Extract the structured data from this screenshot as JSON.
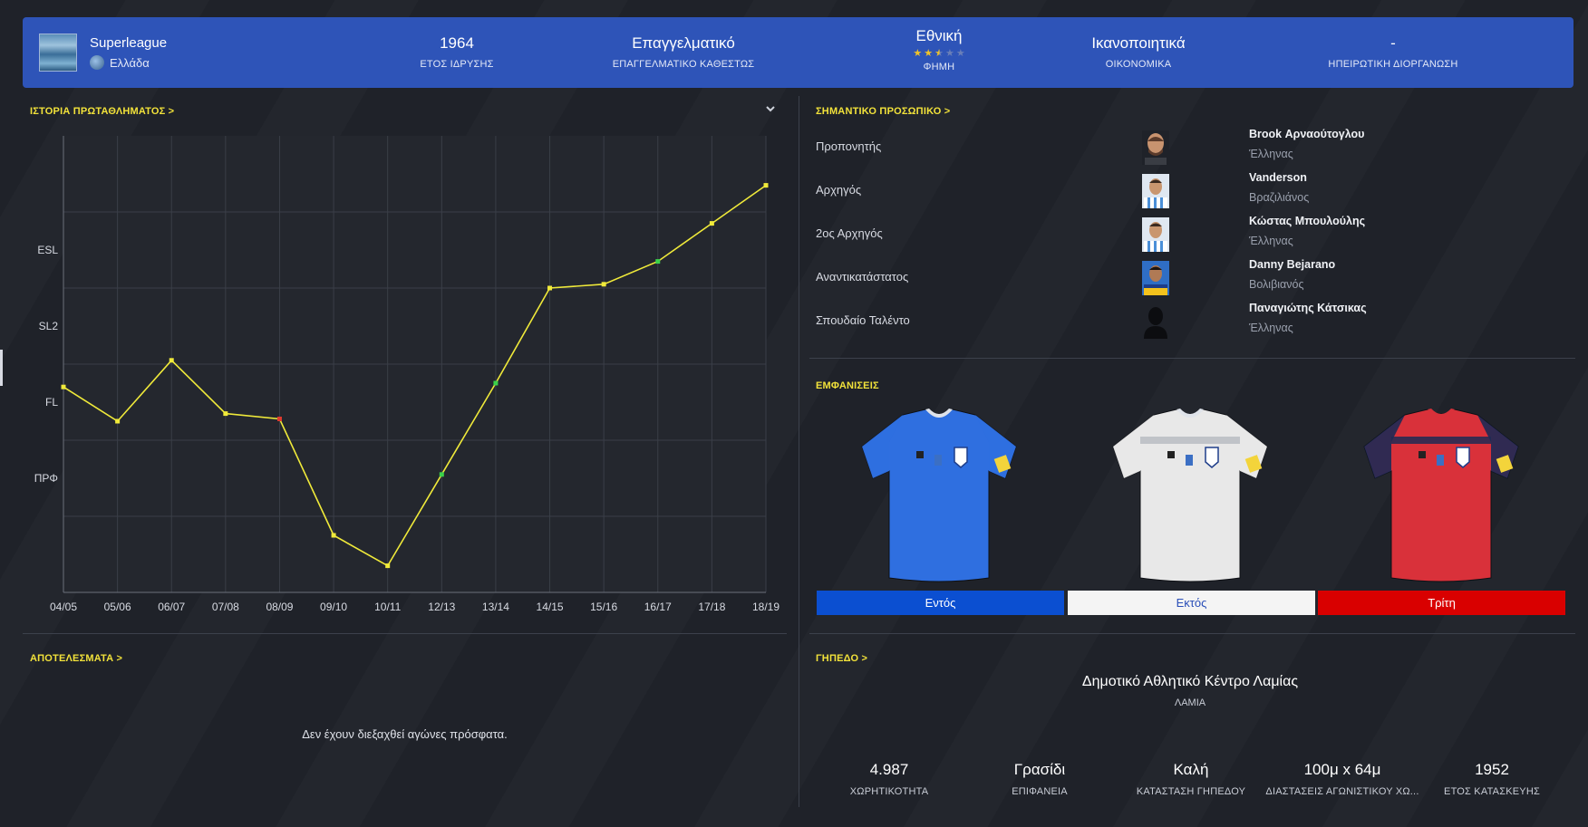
{
  "header": {
    "competition": "Superleague",
    "country": "Ελλάδα",
    "stats": [
      {
        "value": "1964",
        "label": "ΕΤΟΣ ΙΔΡΥΣΗΣ"
      },
      {
        "value": "Επαγγελματικό",
        "label": "ΕΠΑΓΓΕΛΜΑΤΙΚΟ ΚΑΘΕΣΤΩΣ"
      },
      {
        "value": "Εθνική",
        "label": "ΦΗΜΗ",
        "rating": 2.5,
        "rating_max": 5
      },
      {
        "value": "Ικανοποιητικά",
        "label": "ΟΙΚΟΝΟΜΙΚΑ"
      },
      {
        "value": "-",
        "label": "ΗΠΕΙΡΩΤΙΚΗ ΔΙΟΡΓΑΝΩΣΗ"
      }
    ]
  },
  "history": {
    "title": "ΙΣΤΟΡΙΑ ΠΡΩΤΑΘΛΗΜΑΤΟΣ",
    "chevron": ">"
  },
  "chart_data": {
    "type": "line",
    "categories": [
      "04/05",
      "05/06",
      "06/07",
      "07/08",
      "08/09",
      "09/10",
      "10/11",
      "12/13",
      "13/14",
      "14/15",
      "15/16",
      "16/17",
      "17/18",
      "18/19"
    ],
    "values": [
      2.7,
      2.25,
      3.05,
      2.35,
      2.28,
      0.75,
      0.35,
      1.55,
      2.75,
      4.0,
      4.05,
      4.35,
      4.85,
      5.35
    ],
    "point_colors": [
      "#f0ea3a",
      "#f0ea3a",
      "#f0ea3a",
      "#f0ea3a",
      "#e03b2f",
      "#f0ea3a",
      "#f0ea3a",
      "#3bd14a",
      "#3bd14a",
      "#f0ea3a",
      "#f0ea3a",
      "#3bd14a",
      "#f0ea3a",
      "#f0ea3a"
    ],
    "y_tick_labels": [
      {
        "label": "ΠΡΦ",
        "value": 1.5
      },
      {
        "label": "FL",
        "value": 2.5
      },
      {
        "label": "SL2",
        "value": 3.5
      },
      {
        "label": "ESL",
        "value": 4.5
      }
    ],
    "ylim": [
      0,
      6
    ],
    "grid": true,
    "line_color": "#f0ea3a"
  },
  "results": {
    "title": "ΑΠΟΤΕΛΕΣΜΑΤΑ",
    "chevron": ">",
    "empty_text": "Δεν έχουν διεξαχθεί αγώνες πρόσφατα."
  },
  "staff": {
    "title": "ΣΗΜΑΝΤΙΚΟ ΠΡΟΣΩΠΙΚΟ",
    "chevron": ">",
    "rows": [
      {
        "role": "Προπονητής",
        "name": "Brook Αρναούτογλου",
        "nationality": "Έλληνας",
        "face": "coach"
      },
      {
        "role": "Αρχηγός",
        "name": "Vanderson",
        "nationality": "Βραζιλιάνος",
        "face": "player-stripes"
      },
      {
        "role": "2ος Αρχηγός",
        "name": "Κώστας Μπουλούλης",
        "nationality": "Έλληνας",
        "face": "player-stripes"
      },
      {
        "role": "Αναντικατάστατος",
        "name": "Danny Bejarano",
        "nationality": "Βολιβιανός",
        "face": "player-blue"
      },
      {
        "role": "Σπουδαίο Ταλέντο",
        "name": "Παναγιώτης Κάτσικας",
        "nationality": "Έλληνας",
        "face": "silhouette"
      }
    ]
  },
  "kits": {
    "title": "ΕΜΦΑΝΙΣΕΙΣ",
    "items": [
      {
        "label": "Εντός",
        "color": "#2f6fe0",
        "button_bg": "#0b4fd1",
        "button_fg": "#ffffff"
      },
      {
        "label": "Εκτός",
        "color": "#e8e8e8",
        "button_bg": "#f4f4f4",
        "button_fg": "#2b4fb8"
      },
      {
        "label": "Τρίτη",
        "color": "#d9313a",
        "button_bg": "#d90000",
        "button_fg": "#ffffff"
      }
    ]
  },
  "stadium": {
    "title": "ΓΗΠΕΔΟ",
    "chevron": ">",
    "name": "Δημοτικό Αθλητικό Κέντρο Λαμίας",
    "city": "ΛΑΜΙΑ",
    "stats": [
      {
        "value": "4.987",
        "label": "ΧΩΡΗΤΙΚΟΤΗΤΑ"
      },
      {
        "value": "Γρασίδι",
        "label": "ΕΠΙΦΑΝΕΙΑ"
      },
      {
        "value": "Καλή",
        "label": "ΚΑΤΑΣΤΑΣΗ ΓΗΠΕΔΟΥ"
      },
      {
        "value": "100μ x 64μ",
        "label": "ΔΙΑΣΤΑΣΕΙΣ ΑΓΩΝΙΣΤΙΚΟΥ ΧΩ..."
      },
      {
        "value": "1952",
        "label": "ΕΤΟΣ ΚΑΤΑΣΚΕΥΗΣ"
      }
    ]
  }
}
